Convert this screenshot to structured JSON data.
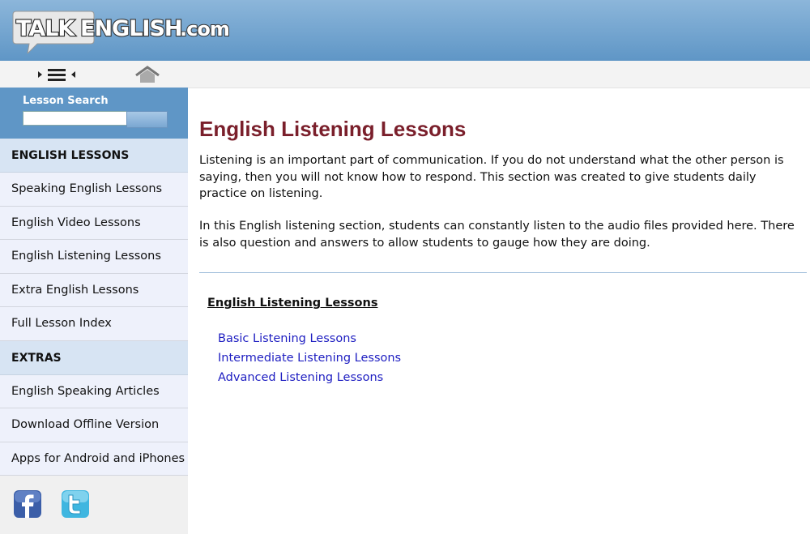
{
  "header": {
    "logo_text": "TALKENGLISH.com",
    "accent": "#5f96c6"
  },
  "navbar": {
    "icons": [
      "menu-arrows-icon",
      "home-icon"
    ]
  },
  "sidebar": {
    "search": {
      "label": "Lesson Search",
      "input_value": ""
    },
    "sections": [
      {
        "header": "ENGLISH LESSONS",
        "items": [
          "Speaking English Lessons",
          "English Video Lessons",
          "English Listening Lessons",
          "Extra English Lessons",
          "Full Lesson Index"
        ]
      },
      {
        "header": "EXTRAS",
        "items": [
          "English Speaking Articles",
          "Download Offline Version",
          "Apps for Android and iPhones"
        ]
      }
    ],
    "social_icons": [
      "facebook-icon",
      "twitter-icon"
    ]
  },
  "main": {
    "title": "English Listening Lessons",
    "paragraphs": [
      "Listening is an important part of communication. If you do not understand what the other person is saying, then you will not know how to respond. This section was created to give students daily practice on listening.",
      "In this English listening section, students can constantly listen to the audio files provided here. There is also question and answers to allow students to gauge how they are doing."
    ],
    "section_title": "English Listening Lessons",
    "links": [
      "Basic Listening Lessons",
      "Intermediate Listening Lessons",
      "Advanced Listening Lessons"
    ],
    "title_color": "#7a1f2b",
    "link_color": "#1d1dc1"
  }
}
